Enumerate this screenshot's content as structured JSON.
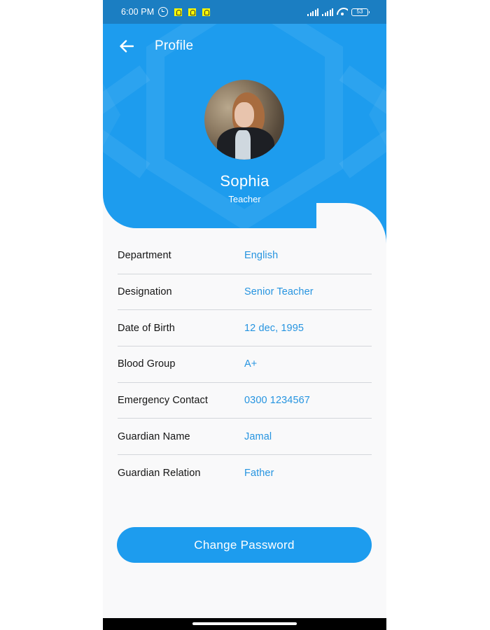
{
  "status_bar": {
    "time": "6:00 PM",
    "notification_icons": [
      "alarm-icon",
      "snapchat-icon",
      "snapchat-icon",
      "snapchat-icon"
    ],
    "battery_level": "53"
  },
  "header": {
    "title": "Profile",
    "back_icon": "arrow-left-icon"
  },
  "profile": {
    "name": "Sophia",
    "role": "Teacher"
  },
  "details": [
    {
      "label": "Department",
      "value": "English"
    },
    {
      "label": "Designation",
      "value": "Senior Teacher"
    },
    {
      "label": "Date of Birth",
      "value": "12 dec, 1995"
    },
    {
      "label": "Blood Group",
      "value": "A+"
    },
    {
      "label": "Emergency Contact",
      "value": "0300 1234567"
    },
    {
      "label": "Guardian Name",
      "value": "Jamal"
    },
    {
      "label": "Guardian Relation",
      "value": "Father"
    }
  ],
  "actions": {
    "change_password_label": "Change Password"
  },
  "colors": {
    "primary": "#1d9cee",
    "status_bar": "#1b7ec2",
    "value_text": "#2694e0",
    "background": "#f9f9fa"
  }
}
